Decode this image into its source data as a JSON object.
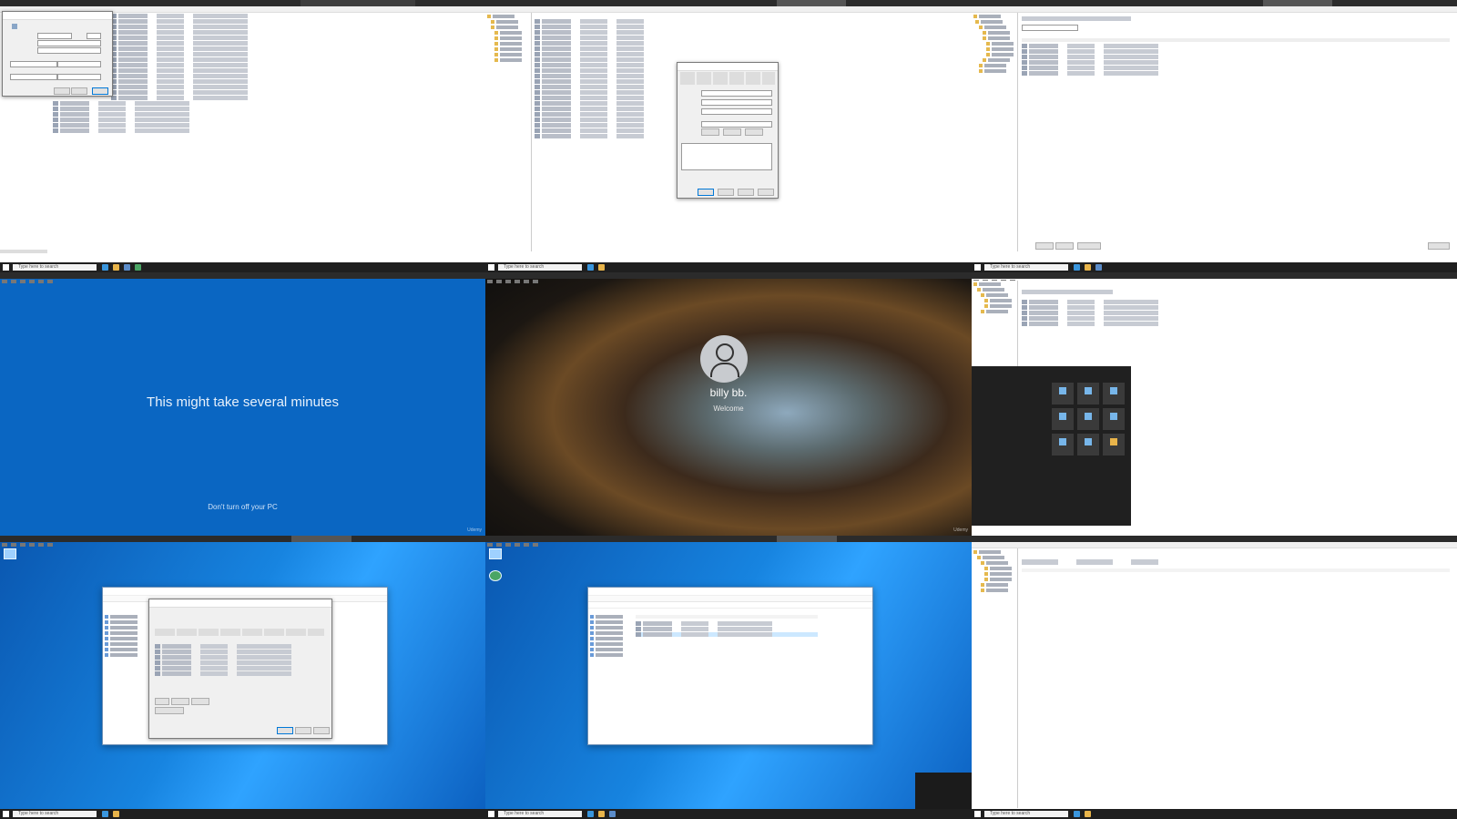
{
  "taskbar": {
    "search_placeholder": "Type here to search"
  },
  "update_screen": {
    "message": "This might take several minutes",
    "sub_message": "Don't turn off your PC",
    "watermark": "Udemy"
  },
  "login_screen": {
    "username": "billy bb.",
    "status": "Welcome",
    "watermark": "Udemy"
  },
  "colors": {
    "update_blue": "#0a66c2",
    "taskbar": "#1f1f1f",
    "accent": "#0078d7"
  }
}
